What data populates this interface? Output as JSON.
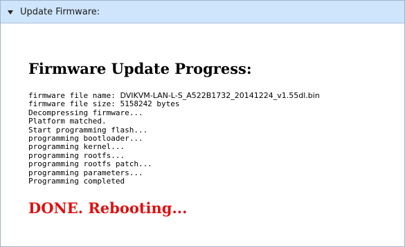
{
  "panel": {
    "title": "Update Firmware:",
    "toggle_icon": "triangle-down-icon"
  },
  "progress": {
    "heading": "Firmware Update Progress:",
    "log": {
      "file_name_label": "firmware file name: ",
      "file_name_value": "DVIKVM-LAN-L-S_A522B1732_20141224_v1.55dl.bin",
      "lines": [
        "firmware file size: 5158242 bytes",
        "Decompressing firmware...",
        "Platform matched.",
        "Start programming flash...",
        "programming bootloader...",
        "programming kernel...",
        "programming rootfs...",
        "programming rootfs patch...",
        "programming parameters...",
        "Programming completed"
      ]
    },
    "status": "DONE. Rebooting...",
    "status_color": "#e01010"
  }
}
